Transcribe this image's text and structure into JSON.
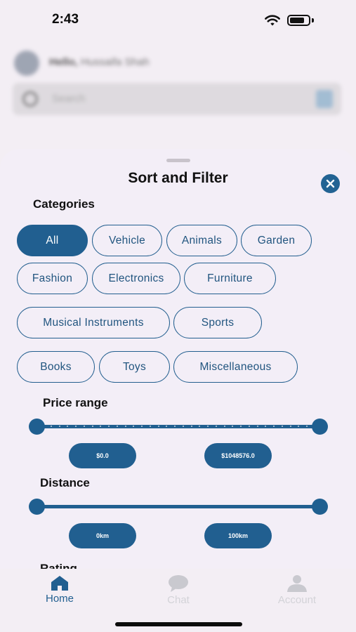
{
  "status_bar": {
    "time": "2:43"
  },
  "background": {
    "greeting_prefix": "Hello,",
    "greeting_name": "Hussaifa Shah",
    "search_placeholder": "Search"
  },
  "sheet": {
    "title": "Sort and Filter",
    "categories_label": "Categories",
    "categories": [
      {
        "label": "All",
        "selected": true
      },
      {
        "label": "Vehicle",
        "selected": false
      },
      {
        "label": "Animals",
        "selected": false
      },
      {
        "label": "Garden",
        "selected": false
      },
      {
        "label": "Fashion",
        "selected": false
      },
      {
        "label": "Electronics",
        "selected": false
      },
      {
        "label": "Furniture",
        "selected": false
      },
      {
        "label": "Musical Instruments",
        "selected": false
      },
      {
        "label": "Sports",
        "selected": false
      },
      {
        "label": "Books",
        "selected": false
      },
      {
        "label": "Toys",
        "selected": false
      },
      {
        "label": "Miscellaneous",
        "selected": false
      }
    ],
    "price_range": {
      "label": "Price range",
      "min_value": "$0.0",
      "max_value": "$1048576.0",
      "min_fraction": 0.0,
      "max_fraction": 1.0
    },
    "distance": {
      "label": "Distance",
      "min_value": "0km",
      "max_value": "100km",
      "min_fraction": 0.0,
      "max_fraction": 1.0
    },
    "rating_label": "Rating"
  },
  "tabbar": {
    "items": [
      {
        "label": "Home",
        "icon": "home-icon",
        "active": true
      },
      {
        "label": "Chat",
        "icon": "chat-icon",
        "active": false
      },
      {
        "label": "Account",
        "icon": "account-icon",
        "active": false
      }
    ]
  },
  "colors": {
    "accent": "#215f90",
    "sheet_bg": "#f3eef7",
    "inactive_tab": "#c9c9cf"
  }
}
